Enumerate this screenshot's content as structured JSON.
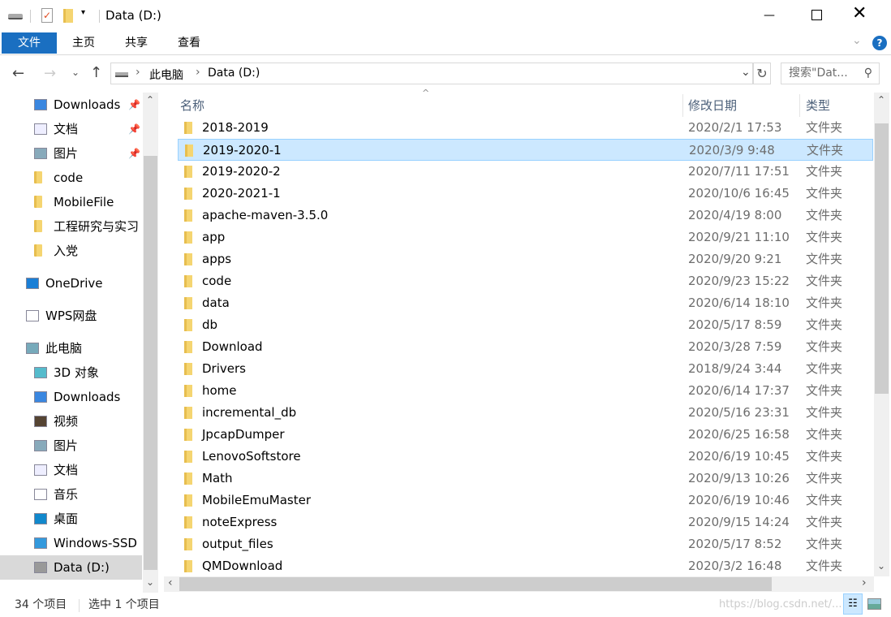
{
  "window": {
    "title": "Data (D:)",
    "accent": "#1a6fc1"
  },
  "ribbon": {
    "tabs": [
      {
        "label": "文件"
      },
      {
        "label": "主页"
      },
      {
        "label": "共享"
      },
      {
        "label": "查看"
      }
    ]
  },
  "address": {
    "crumbs": [
      "此电脑",
      "Data (D:)"
    ],
    "search_placeholder": "搜索\"Dat..."
  },
  "nav": {
    "items": [
      {
        "label": "Downloads",
        "icon": "download-arrow-icon",
        "pinned": true
      },
      {
        "label": "文档",
        "icon": "document-icon",
        "pinned": true
      },
      {
        "label": "图片",
        "icon": "pictures-icon",
        "pinned": true
      },
      {
        "label": "code",
        "icon": "folder-icon"
      },
      {
        "label": "MobileFile",
        "icon": "folder-icon"
      },
      {
        "label": "工程研究与实习",
        "icon": "folder-icon"
      },
      {
        "label": "入党",
        "icon": "folder-icon"
      },
      {
        "label": "OneDrive",
        "icon": "cloud-icon"
      },
      {
        "label": "WPS网盘",
        "icon": "cloud-outline-icon"
      },
      {
        "label": "此电脑",
        "icon": "computer-icon"
      },
      {
        "label": "3D 对象",
        "icon": "cube-icon"
      },
      {
        "label": "Downloads",
        "icon": "download-arrow-icon"
      },
      {
        "label": "视频",
        "icon": "video-icon"
      },
      {
        "label": "图片",
        "icon": "pictures-icon"
      },
      {
        "label": "文档",
        "icon": "document-icon"
      },
      {
        "label": "音乐",
        "icon": "music-icon"
      },
      {
        "label": "桌面",
        "icon": "desktop-icon"
      },
      {
        "label": "Windows-SSD (",
        "icon": "windows-drive-icon"
      },
      {
        "label": "Data (D:)",
        "icon": "drive-icon",
        "selected": true
      }
    ]
  },
  "columns": {
    "name": "名称",
    "date": "修改日期",
    "type": "类型"
  },
  "files": [
    {
      "name": "2018-2019",
      "date": "2020/2/1 17:53",
      "type": "文件夹"
    },
    {
      "name": "2019-2020-1",
      "date": "2020/3/9 9:48",
      "type": "文件夹",
      "selected": true
    },
    {
      "name": "2019-2020-2",
      "date": "2020/7/11 17:51",
      "type": "文件夹"
    },
    {
      "name": "2020-2021-1",
      "date": "2020/10/6 16:45",
      "type": "文件夹"
    },
    {
      "name": "apache-maven-3.5.0",
      "date": "2020/4/19 8:00",
      "type": "文件夹"
    },
    {
      "name": "app",
      "date": "2020/9/21 11:10",
      "type": "文件夹"
    },
    {
      "name": "apps",
      "date": "2020/9/20 9:21",
      "type": "文件夹"
    },
    {
      "name": "code",
      "date": "2020/9/23 15:22",
      "type": "文件夹"
    },
    {
      "name": "data",
      "date": "2020/6/14 18:10",
      "type": "文件夹"
    },
    {
      "name": "db",
      "date": "2020/5/17 8:59",
      "type": "文件夹"
    },
    {
      "name": "Download",
      "date": "2020/3/28 7:59",
      "type": "文件夹"
    },
    {
      "name": "Drivers",
      "date": "2018/9/24 3:44",
      "type": "文件夹"
    },
    {
      "name": "home",
      "date": "2020/6/14 17:37",
      "type": "文件夹"
    },
    {
      "name": "incremental_db",
      "date": "2020/5/16 23:31",
      "type": "文件夹"
    },
    {
      "name": "JpcapDumper",
      "date": "2020/6/25 16:58",
      "type": "文件夹"
    },
    {
      "name": "LenovoSoftstore",
      "date": "2020/6/19 10:45",
      "type": "文件夹"
    },
    {
      "name": "Math",
      "date": "2020/9/13 10:26",
      "type": "文件夹"
    },
    {
      "name": "MobileEmuMaster",
      "date": "2020/6/19 10:46",
      "type": "文件夹"
    },
    {
      "name": "noteExpress",
      "date": "2020/9/15 14:24",
      "type": "文件夹"
    },
    {
      "name": "output_files",
      "date": "2020/5/17 8:52",
      "type": "文件夹"
    },
    {
      "name": "QMDownload",
      "date": "2020/3/2 16:48",
      "type": "文件夹"
    }
  ],
  "status": {
    "count": "34 个项目",
    "selected": "选中 1 个项目",
    "watermark": "https://blog.csdn.net/..."
  }
}
